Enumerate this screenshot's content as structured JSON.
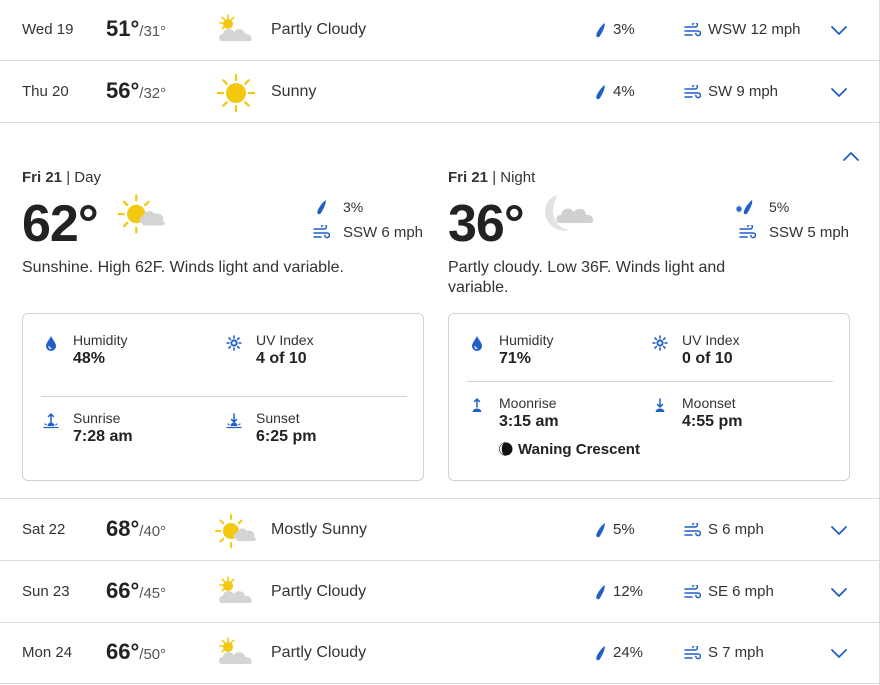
{
  "forecast_before": [
    {
      "date": "Wed 19",
      "high": "51°",
      "low": "/31°",
      "condition": "Partly Cloudy",
      "icon": "partly-cloudy-icon",
      "precip": "3%",
      "wind": "WSW 12 mph"
    },
    {
      "date": "Thu 20",
      "high": "56°",
      "low": "/32°",
      "condition": "Sunny",
      "icon": "sunny-icon",
      "precip": "4%",
      "wind": "SW 9 mph"
    }
  ],
  "expanded": {
    "day": {
      "title_date": "Fri 21",
      "title_sep": " | ",
      "title_period": "Day",
      "temp": "62°",
      "icon": "mostly-sunny-icon",
      "precip": "3%",
      "wind": "SSW 6 mph",
      "description": "Sunshine. High 62F. Winds light and variable.",
      "details": {
        "humidity_label": "Humidity",
        "humidity_value": "48%",
        "uv_label": "UV Index",
        "uv_value": "4 of 10",
        "sunrise_label": "Sunrise",
        "sunrise_value": "7:28 am",
        "sunset_label": "Sunset",
        "sunset_value": "6:25 pm"
      }
    },
    "night": {
      "title_date": "Fri 21",
      "title_sep": " | ",
      "title_period": "Night",
      "temp": "36°",
      "icon": "partly-cloudy-night-icon",
      "precip": "5%",
      "wind": "SSW 5 mph",
      "description": "Partly cloudy. Low 36F. Winds light and variable.",
      "details": {
        "humidity_label": "Humidity",
        "humidity_value": "71%",
        "uv_label": "UV Index",
        "uv_value": "0 of 10",
        "moonrise_label": "Moonrise",
        "moonrise_value": "3:15 am",
        "moonset_label": "Moonset",
        "moonset_value": "4:55 pm",
        "moon_phase": "Waning Crescent"
      }
    }
  },
  "forecast_after": [
    {
      "date": "Sat 22",
      "high": "68°",
      "low": "/40°",
      "condition": "Mostly Sunny",
      "icon": "mostly-sunny-icon",
      "precip": "5%",
      "wind": "S 6 mph"
    },
    {
      "date": "Sun 23",
      "high": "66°",
      "low": "/45°",
      "condition": "Partly Cloudy",
      "icon": "partly-cloudy-icon",
      "precip": "12%",
      "wind": "SE 6 mph"
    },
    {
      "date": "Mon 24",
      "high": "66°",
      "low": "/50°",
      "condition": "Partly Cloudy",
      "icon": "partly-cloudy-icon",
      "precip": "24%",
      "wind": "S 7 mph"
    }
  ],
  "colors": {
    "accent_blue": "#1f5fc7",
    "sun_yellow": "#f2c811",
    "cloud_gray": "#d4d4d4",
    "divider": "#dcdcdc"
  }
}
